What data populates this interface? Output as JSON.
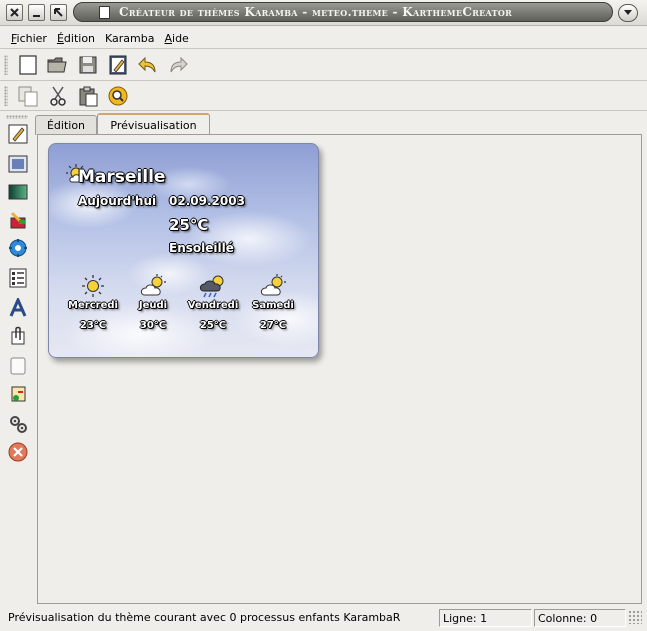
{
  "window": {
    "title": "Créateur de thèmes Karamba - meteo.theme - KarthemeCreator"
  },
  "menubar": {
    "items": [
      "Fichier",
      "Édition",
      "Karamba",
      "Aide"
    ]
  },
  "tabs": [
    {
      "label": "Édition",
      "active": false
    },
    {
      "label": "Prévisualisation",
      "active": true
    }
  ],
  "weather": {
    "city": "Marseille",
    "today_label": "Aujourd'hui",
    "today_date": "02.09.2003",
    "today_temp": "25°C",
    "today_condition": "Ensoleillé",
    "forecast": [
      {
        "day": "Mercredi",
        "temp": "23°C",
        "icon": "sun-icon"
      },
      {
        "day": "Jeudi",
        "temp": "30°C",
        "icon": "sun-cloud-icon"
      },
      {
        "day": "Vendredi",
        "temp": "25°C",
        "icon": "rain-cloud-icon"
      },
      {
        "day": "Samedi",
        "temp": "27°C",
        "icon": "sun-cloud-icon"
      }
    ]
  },
  "statusbar": {
    "message": "Prévisualisation du thème courant avec 0 processus enfants KarambaR",
    "line": "Ligne: 1",
    "column": "Colonne: 0"
  }
}
